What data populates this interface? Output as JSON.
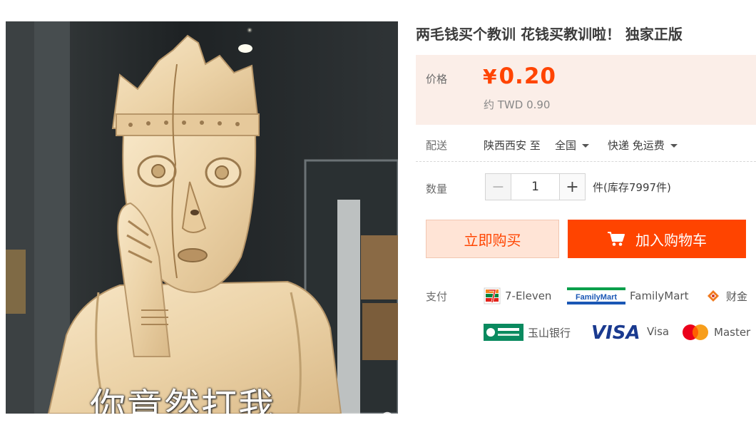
{
  "image": {
    "caption": "你竟然打我",
    "zoom_icon": "magnifier-icon"
  },
  "product": {
    "title": "两毛钱买个教训 花钱买教训啦！ 独家正版"
  },
  "price": {
    "label": "价格",
    "currency_symbol": "¥",
    "amount": "0.20",
    "approx": "约 TWD 0.90",
    "accent_color": "#ff4400",
    "box_color": "#fbeee8"
  },
  "delivery": {
    "label": "配送",
    "from": "陕西西安 至",
    "region": "全国",
    "method": "快递 免运费"
  },
  "quantity": {
    "label": "数量",
    "minus": "−",
    "value": "1",
    "plus": "+",
    "stock": "件(库存7997件)"
  },
  "actions": {
    "buy_now": "立即购买",
    "add_to_cart": "加入购物车",
    "cart_icon": "cart-icon"
  },
  "payment": {
    "label": "支付",
    "methods": [
      {
        "name": "7-Eleven",
        "icon": "seven-eleven-logo"
      },
      {
        "name": "FamilyMart",
        "icon": "familymart-logo",
        "logo_text": "FamilyMart"
      },
      {
        "name": "财金",
        "icon": "fisc-logo"
      },
      {
        "name": "玉山银行",
        "icon": "esun-bank-logo"
      },
      {
        "name": "Visa",
        "icon": "visa-logo",
        "logo_text": "VISA"
      },
      {
        "name": "Master",
        "icon": "mastercard-logo"
      }
    ]
  }
}
